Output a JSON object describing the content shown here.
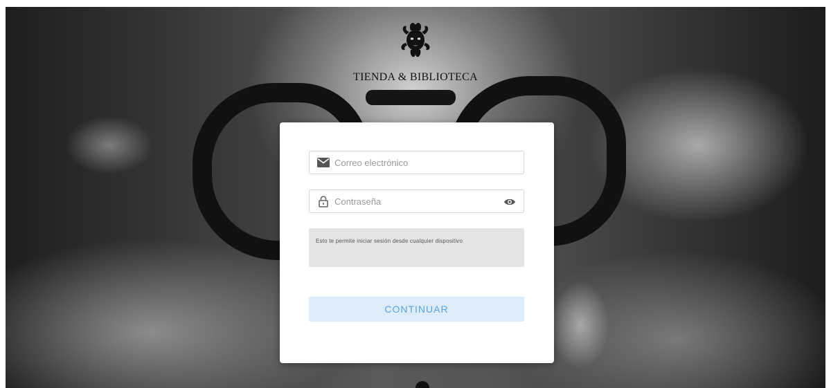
{
  "brand": {
    "name": "TIENDA & BIBLIOTECA",
    "logo_icon": "medusa-head-logo-icon"
  },
  "login": {
    "email_placeholder": "Correo electrónico",
    "email_icon": "envelope-icon",
    "password_placeholder": "Contraseña",
    "password_icon": "lock-icon",
    "show_password_icon": "eye-icon",
    "info_text": "Esto te permite iniciar sesión desde cualquier dispositivo",
    "continue_label": "CONTINUAR"
  },
  "colors": {
    "button_bg": "#dcecf9",
    "button_text": "#5aa3db",
    "info_bg": "#e4e4e4"
  }
}
